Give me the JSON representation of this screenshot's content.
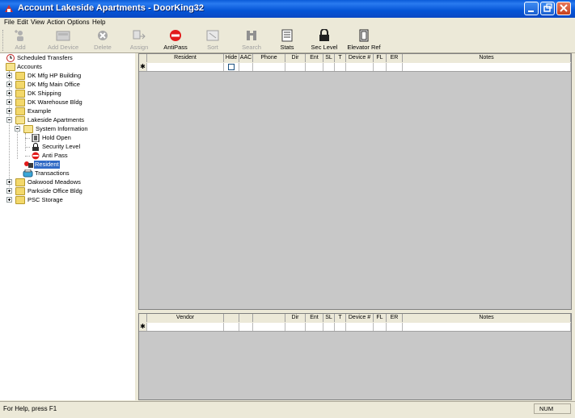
{
  "window": {
    "title": "Account Lakeside Apartments - DoorKing32"
  },
  "menu": [
    "File",
    "Edit",
    "View",
    "Action",
    "Options",
    "Help"
  ],
  "toolbar": [
    {
      "label": "Add",
      "icon": "add-person-icon",
      "enabled": false
    },
    {
      "label": "Add Device",
      "icon": "add-device-icon",
      "enabled": false
    },
    {
      "label": "Delete",
      "icon": "delete-icon",
      "enabled": false
    },
    {
      "label": "Assign",
      "icon": "assign-icon",
      "enabled": false
    },
    {
      "label": "AntiPass",
      "icon": "antipass-icon",
      "enabled": true
    },
    {
      "label": "Sort",
      "icon": "sort-icon",
      "enabled": false
    },
    {
      "label": "Search",
      "icon": "binoculars-icon",
      "enabled": false
    },
    {
      "label": "Stats",
      "icon": "stats-icon",
      "enabled": true
    },
    {
      "label": "Sec Level",
      "icon": "lock-icon",
      "enabled": true
    },
    {
      "label": "Elevator Ref",
      "icon": "elevator-icon",
      "enabled": true
    }
  ],
  "tree": [
    {
      "label": "Scheduled Transfers",
      "level": 0,
      "expander": "none",
      "icon": "clock-icon"
    },
    {
      "label": "Accounts",
      "level": 0,
      "expander": "none",
      "icon": "folder-open-icon"
    },
    {
      "label": "DK Mfg HP Building",
      "level": 1,
      "expander": "plus",
      "icon": "folder-icon"
    },
    {
      "label": "DK Mfg Main Office",
      "level": 1,
      "expander": "plus",
      "icon": "folder-icon"
    },
    {
      "label": "DK Shipping",
      "level": 1,
      "expander": "plus",
      "icon": "folder-icon"
    },
    {
      "label": "DK Warehouse Bldg",
      "level": 1,
      "expander": "plus",
      "icon": "folder-icon"
    },
    {
      "label": "Example",
      "level": 1,
      "expander": "plus",
      "icon": "folder-icon"
    },
    {
      "label": "Lakeside Apartments",
      "level": 1,
      "expander": "minus",
      "icon": "folder-open-icon"
    },
    {
      "label": "System Information",
      "level": 2,
      "expander": "minus",
      "icon": "folder-open-icon"
    },
    {
      "label": "Hold Open",
      "level": 3,
      "expander": "none",
      "icon": "door-icon"
    },
    {
      "label": "Security Level",
      "level": 3,
      "expander": "none",
      "icon": "lock-icon"
    },
    {
      "label": "Anti Pass",
      "level": 3,
      "expander": "none",
      "icon": "antipass-icon"
    },
    {
      "label": "Resident",
      "level": 2,
      "expander": "none",
      "icon": "resident-icon",
      "selected": true
    },
    {
      "label": "Transactions",
      "level": 2,
      "expander": "none",
      "icon": "transactions-icon"
    },
    {
      "label": "Oakwood Meadows",
      "level": 1,
      "expander": "plus",
      "icon": "folder-icon"
    },
    {
      "label": "Parkside Office Bldg",
      "level": 1,
      "expander": "plus",
      "icon": "folder-icon"
    },
    {
      "label": "PSC Storage",
      "level": 1,
      "expander": "plus",
      "icon": "folder-icon"
    }
  ],
  "resident_grid": {
    "columns": [
      "Resident",
      "Hide",
      "AAC",
      "Phone",
      "Dir",
      "Ent",
      "SL",
      "T",
      "Device #",
      "FL",
      "ER",
      "Notes"
    ],
    "new_row_marker": "✱"
  },
  "vendor_grid": {
    "columns": [
      "Vendor",
      "",
      "",
      "",
      "Dir",
      "Ent",
      "SL",
      "T",
      "Device #",
      "FL",
      "ER",
      "Notes"
    ],
    "new_row_marker": "✱"
  },
  "status": {
    "help_text": "For Help, press F1",
    "num_indicator": "NUM"
  }
}
